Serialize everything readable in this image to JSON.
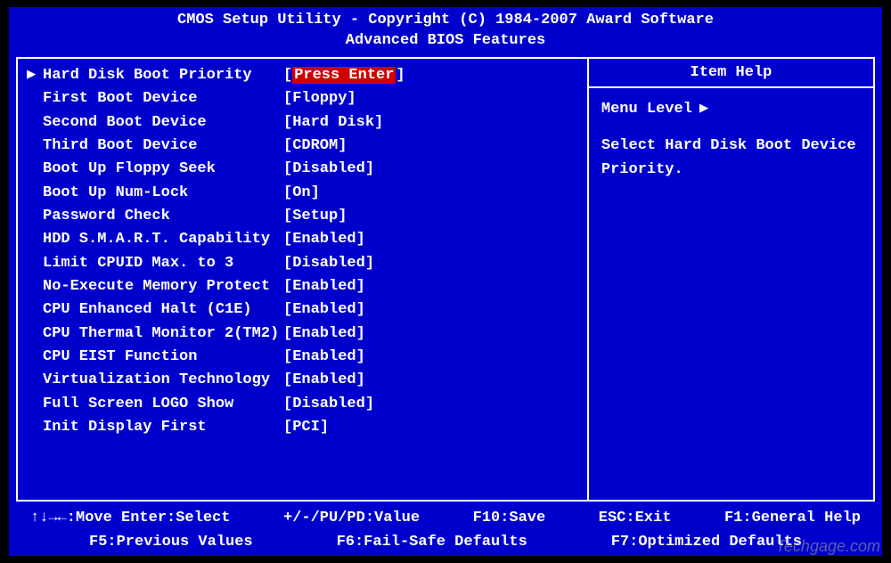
{
  "header": {
    "line1": "CMOS Setup Utility - Copyright (C) 1984-2007 Award Software",
    "line2": "Advanced BIOS Features"
  },
  "items": [
    {
      "cursor": "▶",
      "label": "Hard Disk Boot Priority",
      "value": "Press Enter",
      "highlight": true
    },
    {
      "cursor": "",
      "label": "First Boot Device",
      "value": "Floppy"
    },
    {
      "cursor": "",
      "label": "Second Boot Device",
      "value": "Hard Disk"
    },
    {
      "cursor": "",
      "label": "Third Boot Device",
      "value": "CDROM"
    },
    {
      "cursor": "",
      "label": "Boot Up Floppy Seek",
      "value": "Disabled"
    },
    {
      "cursor": "",
      "label": "Boot Up Num-Lock",
      "value": "On"
    },
    {
      "cursor": "",
      "label": "Password Check",
      "value": "Setup"
    },
    {
      "cursor": "",
      "label": "HDD S.M.A.R.T. Capability",
      "value": "Enabled"
    },
    {
      "cursor": "",
      "label": "Limit CPUID Max. to 3",
      "value": "Disabled"
    },
    {
      "cursor": "",
      "label": "No-Execute Memory Protect",
      "value": "Enabled"
    },
    {
      "cursor": "",
      "label": "CPU Enhanced Halt (C1E)",
      "value": "Enabled"
    },
    {
      "cursor": "",
      "label": "CPU Thermal Monitor 2(TM2)",
      "value": "Enabled"
    },
    {
      "cursor": "",
      "label": "CPU EIST Function",
      "value": "Enabled"
    },
    {
      "cursor": "",
      "label": "Virtualization Technology",
      "value": "Enabled"
    },
    {
      "cursor": "",
      "label": "Full Screen LOGO Show",
      "value": "Disabled"
    },
    {
      "cursor": "",
      "label": "Init Display First",
      "value": "PCI"
    }
  ],
  "help": {
    "title": "Item Help",
    "menu_level_label": "Menu Level",
    "menu_level_icon": "▶",
    "description": "Select Hard Disk Boot Device Priority."
  },
  "footer": {
    "line1": [
      "↑↓→←:Move   Enter:Select",
      "+/-/PU/PD:Value",
      "F10:Save",
      "ESC:Exit",
      "F1:General Help"
    ],
    "line2": [
      "F5:Previous Values",
      "F6:Fail-Safe Defaults",
      "F7:Optimized Defaults"
    ]
  },
  "watermark": "Techgage.com"
}
